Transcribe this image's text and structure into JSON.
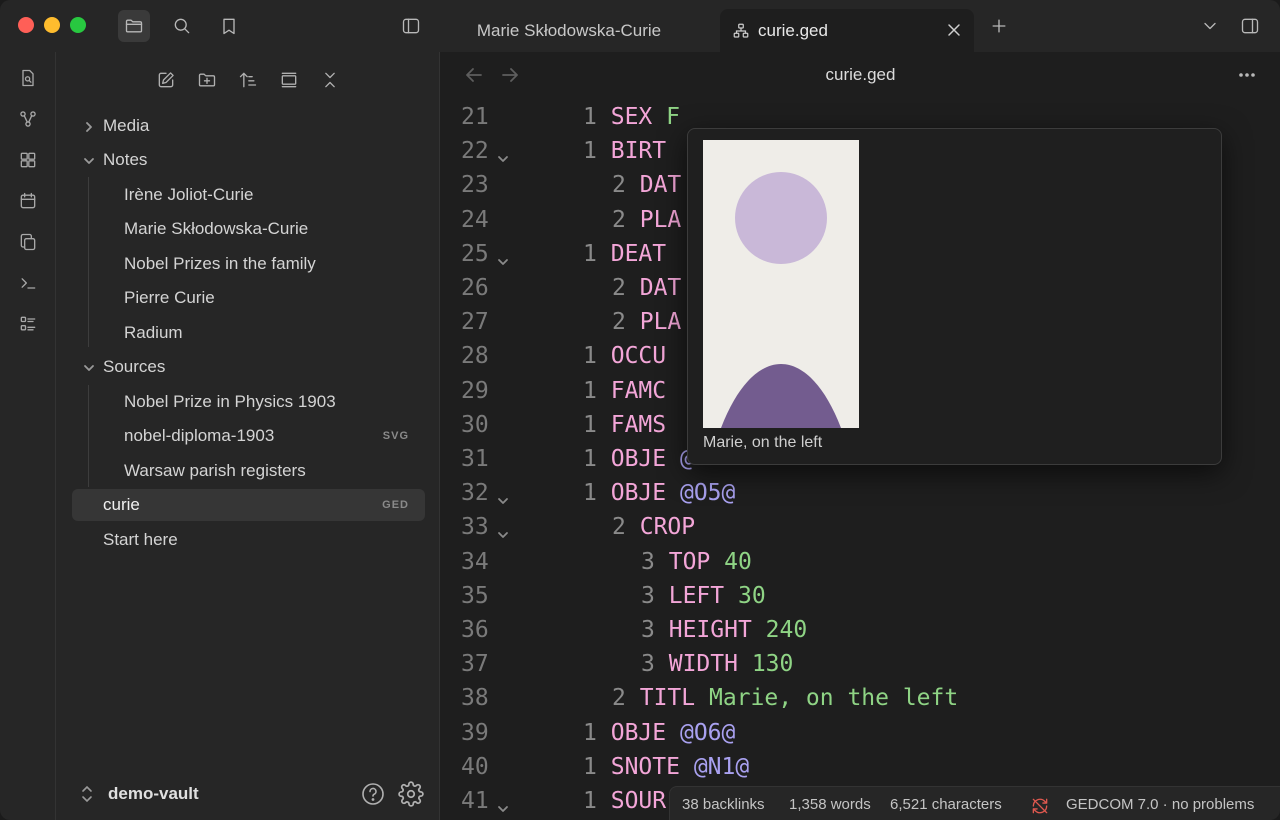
{
  "tabs": [
    {
      "label": "Marie Skłodowska-Curie"
    },
    {
      "label": "curie.ged"
    }
  ],
  "sidebar": {
    "items": [
      {
        "label": "Media",
        "type": "folder",
        "expanded": false
      },
      {
        "label": "Notes",
        "type": "folder",
        "expanded": true
      },
      {
        "label": "Irène Joliot-Curie",
        "type": "file"
      },
      {
        "label": "Marie Skłodowska-Curie",
        "type": "file"
      },
      {
        "label": "Nobel Prizes in the family",
        "type": "file"
      },
      {
        "label": "Pierre Curie",
        "type": "file"
      },
      {
        "label": "Radium",
        "type": "file"
      },
      {
        "label": "Sources",
        "type": "folder",
        "expanded": true
      },
      {
        "label": "Nobel Prize in Physics 1903",
        "type": "file"
      },
      {
        "label": "nobel-diploma-1903",
        "type": "file",
        "badge": "SVG"
      },
      {
        "label": "Warsaw parish registers",
        "type": "file"
      },
      {
        "label": "curie",
        "type": "file",
        "badge": "GED",
        "selected": true
      },
      {
        "label": "Start here",
        "type": "file"
      }
    ],
    "vault_name": "demo-vault"
  },
  "editor": {
    "title": "curie.ged",
    "lines": [
      {
        "n": "21",
        "lvl": "1",
        "tag": "SEX",
        "val": "F"
      },
      {
        "n": "22",
        "lvl": "1",
        "tag": "BIRT",
        "fold": true
      },
      {
        "n": "23",
        "lvl": "2",
        "tag": "DAT"
      },
      {
        "n": "24",
        "lvl": "2",
        "tag": "PLA"
      },
      {
        "n": "25",
        "lvl": "1",
        "tag": "DEAT",
        "fold": true
      },
      {
        "n": "26",
        "lvl": "2",
        "tag": "DAT"
      },
      {
        "n": "27",
        "lvl": "2",
        "tag": "PLA"
      },
      {
        "n": "28",
        "lvl": "1",
        "tag": "OCCU"
      },
      {
        "n": "29",
        "lvl": "1",
        "tag": "FAMC"
      },
      {
        "n": "30",
        "lvl": "1",
        "tag": "FAMS"
      },
      {
        "n": "31",
        "lvl": "1",
        "tag": "OBJE",
        "ptr": "@"
      },
      {
        "n": "32",
        "lvl": "1",
        "tag": "OBJE",
        "ptr": "@O5@",
        "fold": true
      },
      {
        "n": "33",
        "lvl": "2",
        "tag": "CROP",
        "fold": true
      },
      {
        "n": "34",
        "lvl": "3",
        "tag": "TOP",
        "val": "40"
      },
      {
        "n": "35",
        "lvl": "3",
        "tag": "LEFT",
        "val": "30"
      },
      {
        "n": "36",
        "lvl": "3",
        "tag": "HEIGHT",
        "val": "240"
      },
      {
        "n": "37",
        "lvl": "3",
        "tag": "WIDTH",
        "val": "130"
      },
      {
        "n": "38",
        "lvl": "2",
        "tag": "TITL",
        "val": "Marie, on the left"
      },
      {
        "n": "39",
        "lvl": "1",
        "tag": "OBJE",
        "ptr": "@O6@"
      },
      {
        "n": "40",
        "lvl": "1",
        "tag": "SNOTE",
        "ptr": "@N1@"
      },
      {
        "n": "41",
        "lvl": "1",
        "tag": "SOUR",
        "fold": true
      }
    ]
  },
  "popover": {
    "caption": "Marie, on the left",
    "image_colors": {
      "background": "#efede8",
      "head": "#c9b8d8",
      "body": "#735c8f"
    }
  },
  "statusbar": {
    "backlinks": "38 backlinks",
    "words": "1,358 words",
    "characters": "6,521 characters",
    "lint": "GEDCOM 7.0 · no problems"
  },
  "colors": {
    "tag": "#f3a6d8",
    "value": "#8fd485",
    "pointer": "#a9a1f0",
    "sync_error": "#e0584f"
  }
}
